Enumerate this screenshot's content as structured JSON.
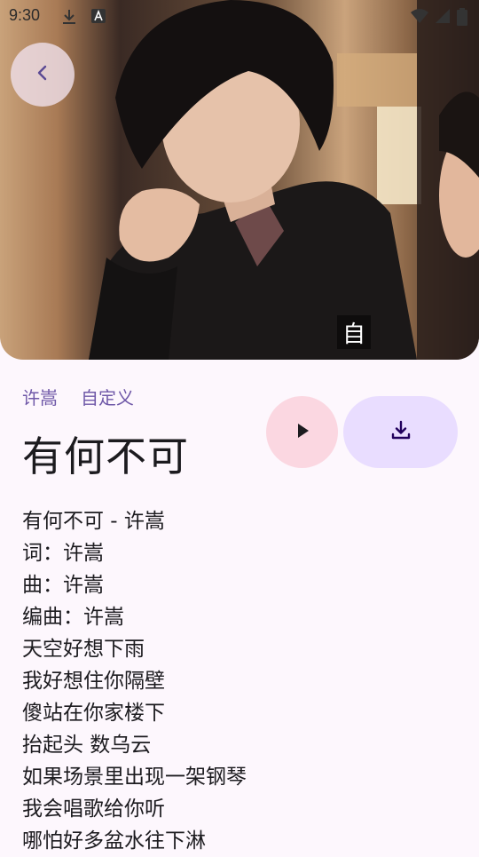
{
  "status_bar": {
    "time": "9:30",
    "icons": [
      "download-icon",
      "font-a-icon",
      "wifi-icon",
      "signal-icon",
      "battery-icon"
    ]
  },
  "cover": {
    "art_text": "自"
  },
  "back_button": {
    "icon": "chevron-left-icon"
  },
  "song": {
    "tags": [
      "许嵩",
      "自定义"
    ],
    "title": "有何不可"
  },
  "actions": {
    "play_icon": "play-icon",
    "download_icon": "download-icon"
  },
  "lyrics": [
    "有何不可 - 许嵩",
    "词：许嵩",
    "曲：许嵩",
    "编曲：许嵩",
    "天空好想下雨",
    "我好想住你隔壁",
    "傻站在你家楼下",
    "抬起头 数乌云",
    "如果场景里出现一架钢琴",
    "我会唱歌给你听",
    "哪怕好多盆水往下淋"
  ],
  "colors": {
    "background": "#fdf7fd",
    "accent_text": "#6f58a8",
    "play_button": "#fbd7e1",
    "download_button": "#e9ddff"
  }
}
